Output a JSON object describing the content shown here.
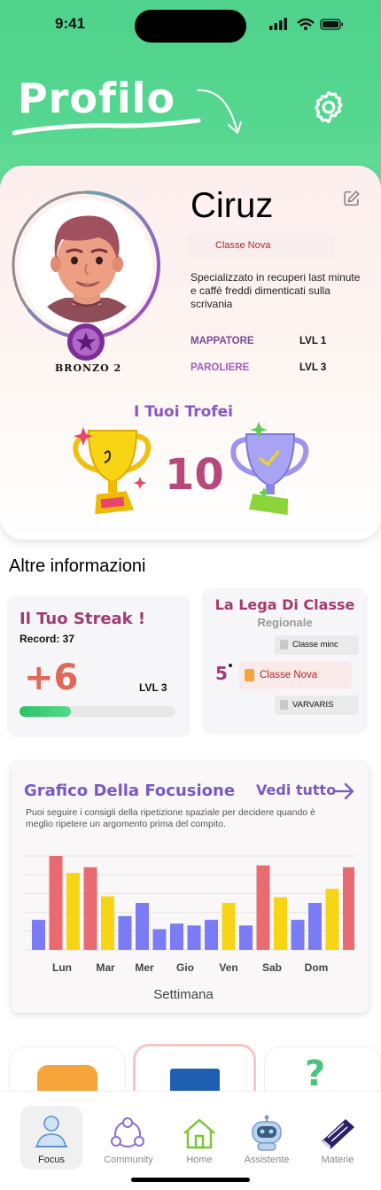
{
  "status_bar": {
    "time": "9:41"
  },
  "header": {
    "title": "Profilo"
  },
  "profile": {
    "name": "Ciruz",
    "class_name": "Classe Nova",
    "bio": "Specializzato in recuperi last minute e caffè freddi dimenticati sulla scrivania",
    "rank": "BRONZO 2",
    "skills": [
      {
        "name": "MAPPATORE",
        "level": "LVL 1",
        "color": "#7a4a9a"
      },
      {
        "name": "PAROLIERE",
        "level": "LVL 3",
        "color": "#a25ac8"
      }
    ],
    "trophies_title": "I Tuoi Trofei",
    "trophies_count": "10"
  },
  "other_info": {
    "title": "Altre informazioni"
  },
  "streak": {
    "title": "Il Tuo Streak !",
    "record": "Record: 37",
    "value": "+6",
    "level": "LVL 3",
    "progress": 0.33
  },
  "league": {
    "title": "La Lega Di Classe",
    "subtitle": "Regionale",
    "position": "5",
    "rows": [
      {
        "name": "Classe minc"
      },
      {
        "name": "Classe Nova"
      },
      {
        "name": "VARVARIS"
      }
    ]
  },
  "focus_chart": {
    "title": "Grafico Della Focusione",
    "see_all": "Vedi tutto",
    "description": "Puoi seguire i consigli della ripetizione spaziale per decidere quando è meglio ripetere un argomento prima del compito."
  },
  "chart_data": {
    "type": "bar",
    "categories": [
      "Lun",
      "Mar",
      "Mer",
      "Gio",
      "Ven",
      "Sab",
      "Dom"
    ],
    "xlabel": "Settimana",
    "ylim": [
      0,
      100
    ],
    "grid": true,
    "bars": [
      {
        "value": 32,
        "color": "#7b7cf5"
      },
      {
        "value": 100,
        "color": "#e86b72"
      },
      {
        "value": 82,
        "color": "#f7d514"
      },
      {
        "value": 88,
        "color": "#e86b72"
      },
      {
        "value": 57,
        "color": "#f7d514"
      },
      {
        "value": 36,
        "color": "#7b7cf5"
      },
      {
        "value": 50,
        "color": "#7b7cf5"
      },
      {
        "value": 22,
        "color": "#7b7cf5"
      },
      {
        "value": 28,
        "color": "#7b7cf5"
      },
      {
        "value": 26,
        "color": "#7b7cf5"
      },
      {
        "value": 32,
        "color": "#7b7cf5"
      },
      {
        "value": 50,
        "color": "#f7d514"
      },
      {
        "value": 26,
        "color": "#7b7cf5"
      },
      {
        "value": 90,
        "color": "#e86b72"
      },
      {
        "value": 56,
        "color": "#f7d514"
      },
      {
        "value": 32,
        "color": "#7b7cf5"
      },
      {
        "value": 50,
        "color": "#7b7cf5"
      },
      {
        "value": 65,
        "color": "#f7d514"
      },
      {
        "value": 88,
        "color": "#e86b72"
      },
      {
        "value": 17,
        "color": "#7b7cf5"
      }
    ]
  },
  "nav": {
    "items": [
      {
        "label": "Focus"
      },
      {
        "label": "Community"
      },
      {
        "label": "Home"
      },
      {
        "label": "Assistente"
      },
      {
        "label": "Materie"
      }
    ]
  }
}
